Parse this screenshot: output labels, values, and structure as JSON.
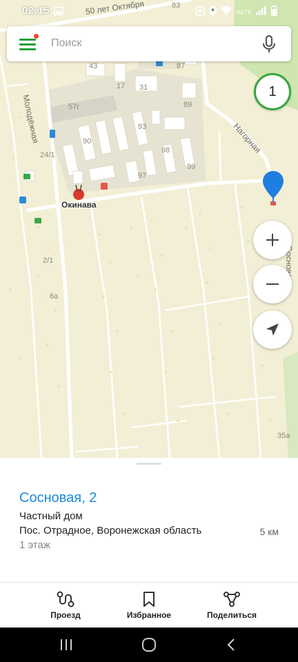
{
  "status_bar": {
    "time": "02:15",
    "network": "VoLTE"
  },
  "search": {
    "placeholder": "Поиск"
  },
  "map": {
    "top_street": "50 лет Октября",
    "streets": [
      "Молодёжная",
      "Нагорная",
      "Сосновая"
    ],
    "house_numbers": [
      "83",
      "87",
      "43",
      "17",
      "31",
      "89",
      "57г",
      "93",
      "90",
      "98",
      "24/1",
      "99",
      "97",
      "2/1",
      "6а",
      "35а"
    ],
    "poi_name": "Окинава",
    "results_count": "1"
  },
  "place": {
    "title": "Сосновая, 2",
    "type": "Частный дом",
    "address": "Пос. Отрадное, Воронежская область",
    "distance": "5 км",
    "floors": "1 этаж"
  },
  "actions": {
    "route": "Проезд",
    "favorites": "Избранное",
    "share": "Поделиться"
  },
  "colors": {
    "accent_green": "#1ba136",
    "title_blue": "#1b8ad9",
    "pin_blue": "#1e7fe0",
    "map_bg": "#f3efd6"
  },
  "icons": {
    "menu": "hamburger-icon",
    "mic": "microphone-icon",
    "zoom_in": "plus-icon",
    "zoom_out": "minus-icon",
    "locate": "navigation-arrow-icon",
    "route": "route-icon",
    "favorites": "bookmark-icon",
    "share": "share-icon"
  }
}
